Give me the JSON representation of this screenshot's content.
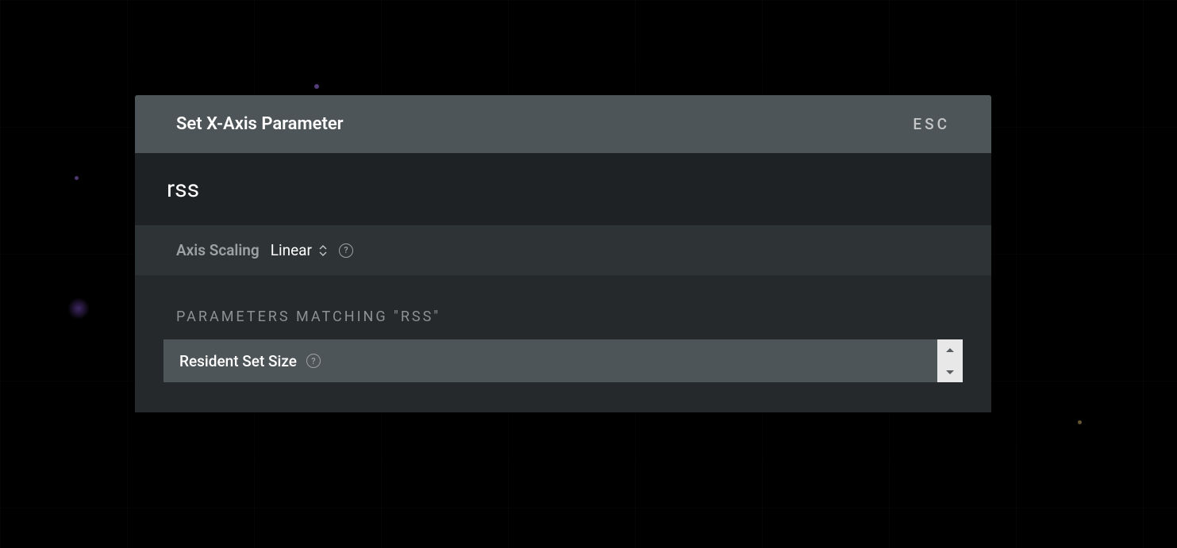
{
  "modal": {
    "title": "Set X-Axis Parameter",
    "esc_label": "ESC"
  },
  "search": {
    "value": "rss"
  },
  "scaling": {
    "label": "Axis Scaling",
    "value": "Linear"
  },
  "results": {
    "header": "PARAMETERS MATCHING \"RSS\"",
    "items": [
      {
        "label": "Resident Set Size"
      }
    ]
  }
}
